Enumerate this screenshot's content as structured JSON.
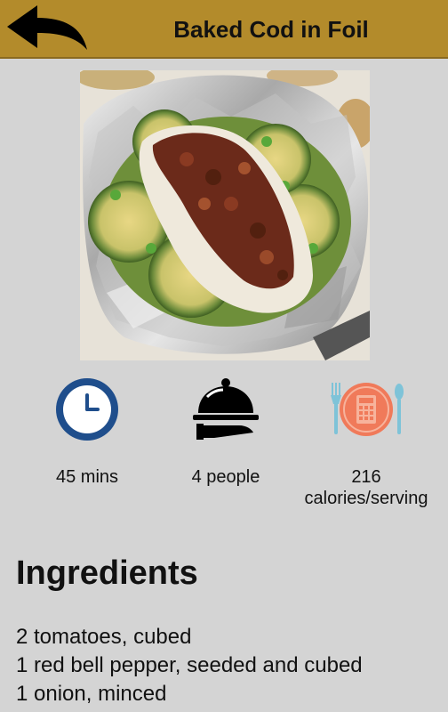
{
  "header": {
    "title": "Baked Cod in Foil",
    "back_icon": "back-arrow-icon",
    "background_color": "#b38b2b"
  },
  "photo": {
    "subject": "baked cod fillet in foil"
  },
  "stats": [
    {
      "icon": "clock-icon",
      "label": "45 mins",
      "color": "#1f4e8c"
    },
    {
      "icon": "serving-cloche-icon",
      "label": "4 people",
      "color": "#000000"
    },
    {
      "icon": "calculator-plate-icon",
      "label": "216\ncalories/serving",
      "color": "#f07a5a"
    }
  ],
  "ingredients": {
    "heading": "Ingredients",
    "items": [
      "2 tomatoes, cubed",
      "1 red bell pepper, seeded and cubed",
      "1 onion, minced"
    ]
  }
}
